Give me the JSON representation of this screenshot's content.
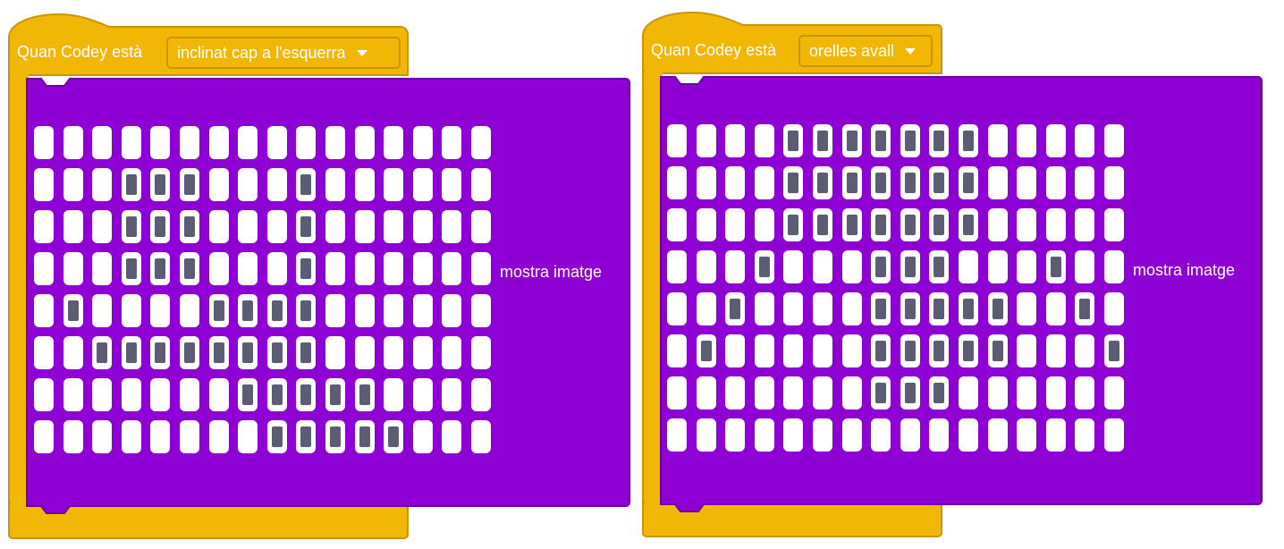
{
  "colors": {
    "event_block": "#f2b705",
    "event_border": "#c99504",
    "display_block": "#8f00d4",
    "display_border": "#6f00a6",
    "led_off": "#ffffff",
    "led_on": "#5b5e72"
  },
  "blocks": [
    {
      "hat_label": "Quan Codey està",
      "dropdown_value": "inclinat cap a l'esquerra",
      "action_label": "mostra imatge",
      "matrix": [
        "0000000000000000",
        "0001110001000000",
        "0001110001000000",
        "0001110001000000",
        "0100001111000000",
        "0011111111000000",
        "0000000111110000",
        "0000000011111000"
      ]
    },
    {
      "hat_label": "Quan Codey està",
      "dropdown_value": "orelles avall",
      "action_label": "mostra imatge",
      "matrix": [
        "0000111111100000",
        "0000111111100000",
        "0000111111100000",
        "0001000111000100",
        "0010000111110010",
        "0100000111110001",
        "0000000111000000",
        "0000000000000000"
      ]
    }
  ]
}
